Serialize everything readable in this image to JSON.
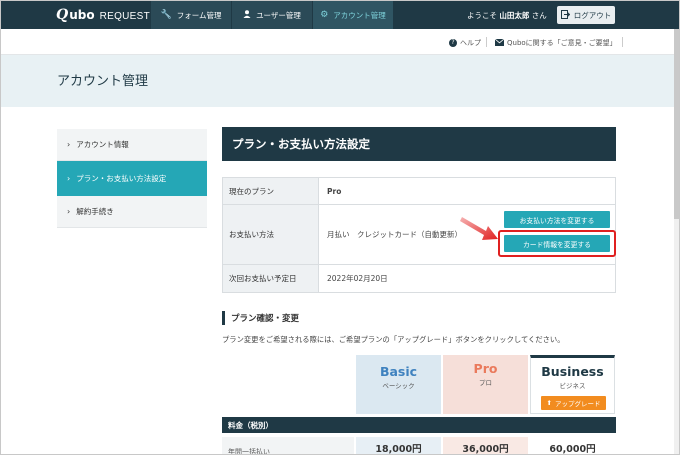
{
  "app": {
    "logo_q": "Q",
    "logo_ubo": "ubo",
    "logo_request": "REQUEST"
  },
  "nav": {
    "tabs": [
      {
        "label": "フォーム管理",
        "icon": "wrench-icon"
      },
      {
        "label": "ユーザー管理",
        "icon": "user-icon"
      },
      {
        "label": "アカウント管理",
        "icon": "gear-icon"
      }
    ],
    "welcome_prefix": "ようこそ",
    "user_name": "山田太郎",
    "welcome_suffix": "さん",
    "logout_label": "ログアウト"
  },
  "utility": {
    "help_label": "ヘルプ",
    "feedback_label": "Quboに関する「ご意見・ご要望」"
  },
  "page": {
    "title": "アカウント管理"
  },
  "sidebar": {
    "items": [
      {
        "label": "アカウント情報"
      },
      {
        "label": "プラン・お支払い方法設定"
      },
      {
        "label": "解約手続き"
      }
    ]
  },
  "section": {
    "title": "プラン・お支払い方法設定",
    "rows": [
      {
        "label": "現在のプラン",
        "value": "Pro"
      },
      {
        "label": "お支払い方法",
        "value": "月払い　クレジットカード（自動更新）"
      },
      {
        "label": "次回お支払い予定日",
        "value": "2022年02月20日"
      }
    ],
    "change_payment_button": "お支払い方法を変更する",
    "change_card_button": "カード情報を変更する"
  },
  "plan_change": {
    "title": "プラン確認・変更",
    "description": "プラン変更をご希望される際には、ご希望プランの「アップグレード」ボタンをクリックしてください。",
    "plans": [
      {
        "name": "Basic",
        "kana": "ベーシック"
      },
      {
        "name": "Pro",
        "kana": "プロ"
      },
      {
        "name": "Business",
        "kana": "ビジネス"
      }
    ],
    "upgrade_label": "アップグレード",
    "fee_header": "料金（税別）",
    "fee_row_label": "年間一括払い",
    "fees": [
      "18,000円",
      "36,000円",
      "60,000円"
    ]
  },
  "colors": {
    "nav_bg": "#1f3945",
    "accent_teal": "#25a7b6",
    "upgrade_orange": "#f28c1f",
    "highlight_red": "#e02020"
  }
}
